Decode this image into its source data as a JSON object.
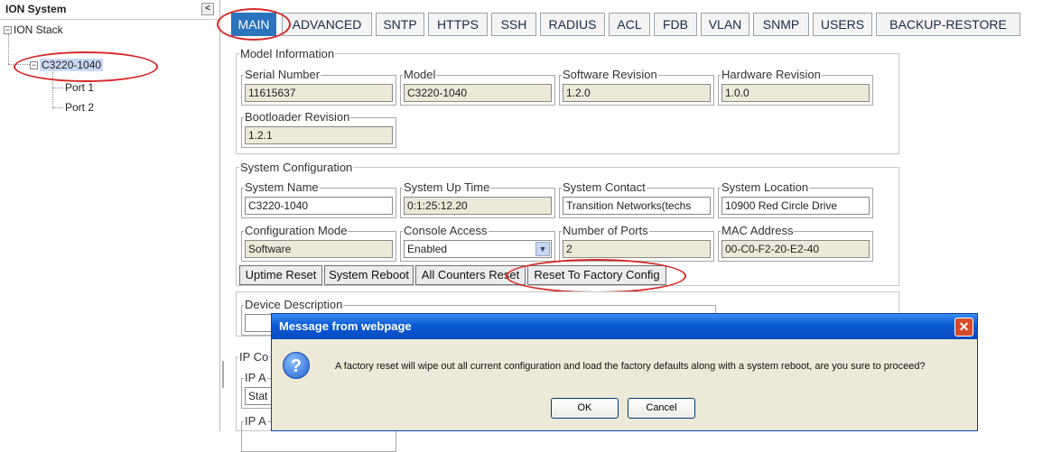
{
  "left_panel": {
    "title": "ION System",
    "collapse_symbol": "<",
    "tree": {
      "root": "ION Stack",
      "device": "C3220-1040",
      "ports": [
        "Port 1",
        "Port 2"
      ]
    }
  },
  "tabs": [
    "MAIN",
    "ADVANCED",
    "SNTP",
    "HTTPS",
    "SSH",
    "RADIUS",
    "ACL",
    "FDB",
    "VLAN",
    "SNMP",
    "USERS",
    "BACKUP-RESTORE"
  ],
  "active_tab": "MAIN",
  "model_information": {
    "title": "Model Information",
    "fields": [
      {
        "label": "Serial Number",
        "value": "11615637"
      },
      {
        "label": "Model",
        "value": "C3220-1040"
      },
      {
        "label": "Software Revision",
        "value": "1.2.0"
      },
      {
        "label": "Hardware Revision",
        "value": "1.0.0"
      },
      {
        "label": "Bootloader Revision",
        "value": "1.2.1"
      }
    ]
  },
  "system_configuration": {
    "title": "System Configuration",
    "fields": [
      {
        "label": "System Name",
        "value": "C3220-1040"
      },
      {
        "label": "System Up Time",
        "value": "0:1:25:12.20"
      },
      {
        "label": "System Contact",
        "value": "Transition Networks(techs"
      },
      {
        "label": "System Location",
        "value": "10900 Red Circle Drive"
      },
      {
        "label": "Configuration Mode",
        "value": "Software"
      },
      {
        "label": "Console Access",
        "value": "Enabled"
      },
      {
        "label": "Number of Ports",
        "value": "2"
      },
      {
        "label": "MAC Address",
        "value": "00-C0-F2-20-E2-40"
      }
    ],
    "buttons": [
      "Uptime Reset",
      "System Reboot",
      "All Counters Reset",
      "Reset To Factory Config"
    ]
  },
  "device_description": {
    "label": "Device Description",
    "value": ""
  },
  "ip_config": {
    "title": "IP Co",
    "field1_label": "IP A",
    "field1_value": "Stat",
    "field2_label": "IP A"
  },
  "dialog": {
    "title": "Message from webpage",
    "close_symbol": "✕",
    "icon_symbol": "?",
    "message": "A factory reset will wipe out all current configuration and load the factory defaults along with a system reboot, are you sure to proceed?",
    "ok_label": "OK",
    "cancel_label": "Cancel"
  },
  "colors": {
    "active_tab": "#2a73bd",
    "annotation": "#d62828",
    "dialog_title": "#0a5ad6"
  }
}
